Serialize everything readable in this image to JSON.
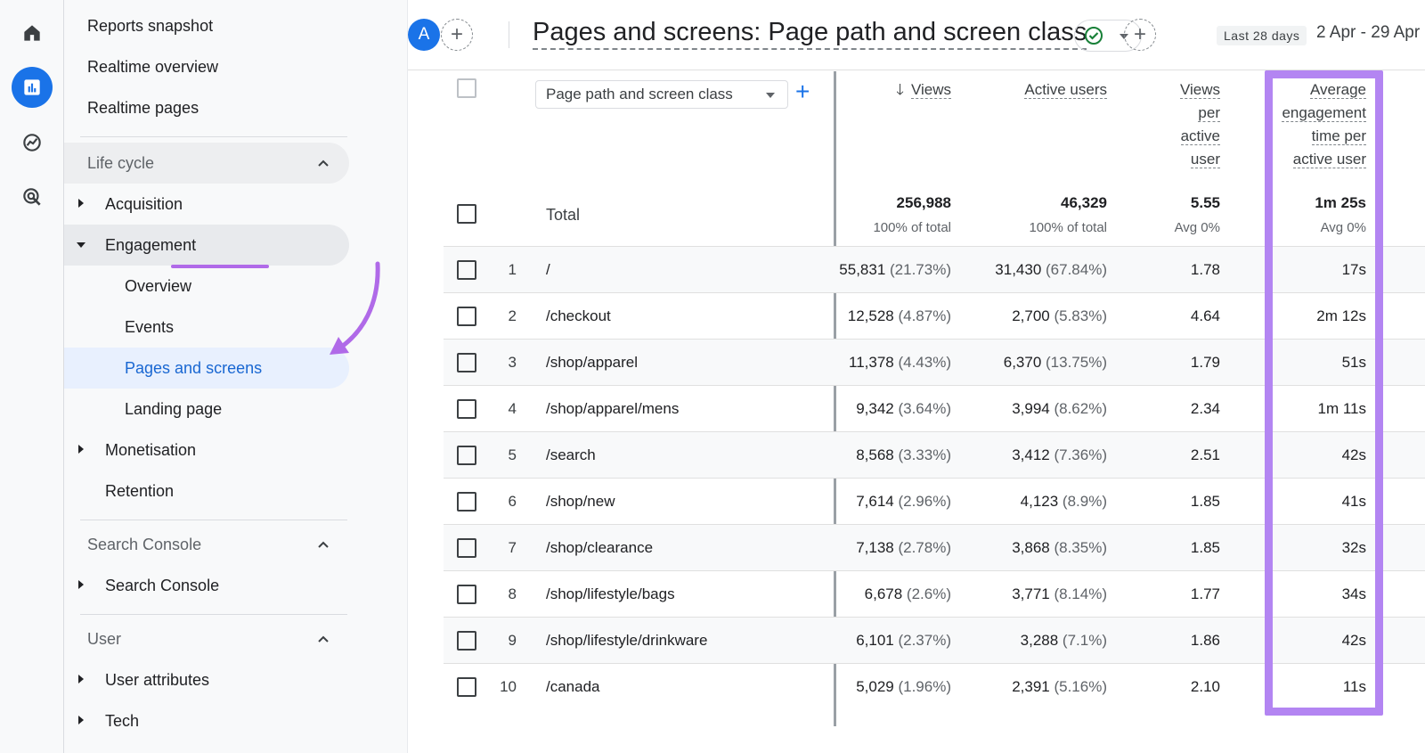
{
  "colors": {
    "accent": "#1a73e8",
    "highlight": "#b385f2",
    "arrow": "#b06ae8",
    "success": "#188038"
  },
  "rail": {
    "icons": [
      "home-icon",
      "reports-icon",
      "explore-icon",
      "advertising-icon"
    ]
  },
  "nav": {
    "top_items": [
      "Reports snapshot",
      "Realtime overview",
      "Realtime pages"
    ],
    "lifecycle_label": "Life cycle",
    "acquisition": "Acquisition",
    "engagement": "Engagement",
    "engagement_children": [
      "Overview",
      "Events",
      "Pages and screens",
      "Landing page"
    ],
    "monetisation": "Monetisation",
    "retention": "Retention",
    "search_console_section": "Search Console",
    "search_console_item": "Search Console",
    "user_section": "User",
    "user_attributes": "User attributes",
    "tech": "Tech"
  },
  "header": {
    "avatar_letter": "A",
    "title": "Pages and screens: Page path and screen class",
    "date_label": "Last 28 days",
    "date_range": "2 Apr - 29 Apr"
  },
  "table": {
    "dimension_selector": "Page path and screen class",
    "columns": {
      "views": "Views",
      "active_users": "Active users",
      "views_per_user": [
        "Views",
        "per",
        "active",
        "user"
      ],
      "avg_engagement": [
        "Average",
        "engagement",
        "time per",
        "active user"
      ]
    },
    "total": {
      "label": "Total",
      "views": "256,988",
      "views_sub": "100% of total",
      "active_users": "46,329",
      "active_users_sub": "100% of total",
      "views_per_user": "5.55",
      "views_per_user_sub": "Avg 0%",
      "avg_engagement": "1m 25s",
      "avg_engagement_sub": "Avg 0%"
    },
    "rows": [
      {
        "idx": "1",
        "path": "/",
        "views": "55,831",
        "views_pct": "(21.73%)",
        "users": "31,430",
        "users_pct": "(67.84%)",
        "vpu": "1.78",
        "eng": "17s"
      },
      {
        "idx": "2",
        "path": "/checkout",
        "views": "12,528",
        "views_pct": "(4.87%)",
        "users": "2,700",
        "users_pct": "(5.83%)",
        "vpu": "4.64",
        "eng": "2m 12s"
      },
      {
        "idx": "3",
        "path": "/shop/apparel",
        "views": "11,378",
        "views_pct": "(4.43%)",
        "users": "6,370",
        "users_pct": "(13.75%)",
        "vpu": "1.79",
        "eng": "51s"
      },
      {
        "idx": "4",
        "path": "/shop/apparel/mens",
        "views": "9,342",
        "views_pct": "(3.64%)",
        "users": "3,994",
        "users_pct": "(8.62%)",
        "vpu": "2.34",
        "eng": "1m 11s"
      },
      {
        "idx": "5",
        "path": "/search",
        "views": "8,568",
        "views_pct": "(3.33%)",
        "users": "3,412",
        "users_pct": "(7.36%)",
        "vpu": "2.51",
        "eng": "42s"
      },
      {
        "idx": "6",
        "path": "/shop/new",
        "views": "7,614",
        "views_pct": "(2.96%)",
        "users": "4,123",
        "users_pct": "(8.9%)",
        "vpu": "1.85",
        "eng": "41s"
      },
      {
        "idx": "7",
        "path": "/shop/clearance",
        "views": "7,138",
        "views_pct": "(2.78%)",
        "users": "3,868",
        "users_pct": "(8.35%)",
        "vpu": "1.85",
        "eng": "32s"
      },
      {
        "idx": "8",
        "path": "/shop/lifestyle/bags",
        "views": "6,678",
        "views_pct": "(2.6%)",
        "users": "3,771",
        "users_pct": "(8.14%)",
        "vpu": "1.77",
        "eng": "34s"
      },
      {
        "idx": "9",
        "path": "/shop/lifestyle/drinkware",
        "views": "6,101",
        "views_pct": "(2.37%)",
        "users": "3,288",
        "users_pct": "(7.1%)",
        "vpu": "1.86",
        "eng": "42s"
      },
      {
        "idx": "10",
        "path": "/canada",
        "views": "5,029",
        "views_pct": "(1.96%)",
        "users": "2,391",
        "users_pct": "(5.16%)",
        "vpu": "2.10",
        "eng": "11s"
      }
    ]
  }
}
